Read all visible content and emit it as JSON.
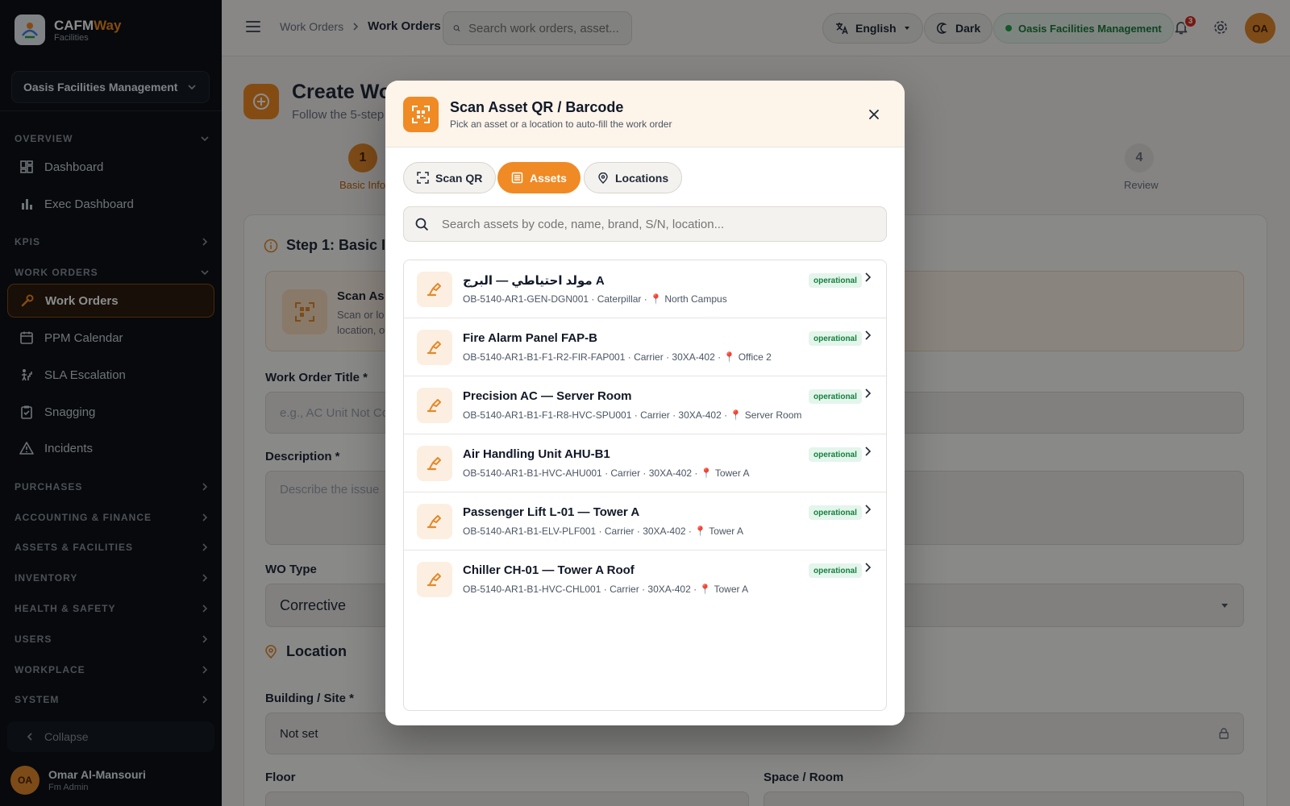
{
  "app": {
    "brand_main": "CAFM",
    "brand_accent": "Way",
    "brand_sub": "Facilities",
    "brand_color": "#f08a24"
  },
  "sidebar": {
    "org_selector": "Oasis Facilities Management",
    "sections": {
      "overview": "OVERVIEW",
      "kpis": "KPIS",
      "work_orders": "WORK ORDERS",
      "purchases": "PURCHASES",
      "accounting": "ACCOUNTING & FINANCE",
      "assets": "ASSETS & FACILITIES",
      "inventory": "INVENTORY",
      "health": "HEALTH & SAFETY",
      "users": "USERS",
      "workplace": "WORKPLACE",
      "system": "SYSTEM"
    },
    "items": {
      "dashboard": "Dashboard",
      "exec_dashboard": "Exec Dashboard",
      "work_orders": "Work Orders",
      "ppm_calendar": "PPM Calendar",
      "sla_escalation": "SLA Escalation",
      "snagging": "Snagging",
      "incidents": "Incidents"
    },
    "collapse": "Collapse",
    "user": {
      "initials": "OA",
      "name": "Omar Al-Mansouri",
      "role": "Fm Admin"
    }
  },
  "topbar": {
    "breadcrumb_parent": "Work Orders",
    "breadcrumb_current": "Work Orders",
    "search_placeholder": "Search work orders, asset...",
    "language": "English",
    "theme": "Dark",
    "org": "Oasis Facilities Management",
    "notification_count": "3",
    "avatar_initials": "OA"
  },
  "page": {
    "title": "Create Wo",
    "subtitle": "Follow the 5-step",
    "step1_number": "1",
    "step1_label": "Basic Info",
    "step4_number": "4",
    "step4_label": "Review",
    "card_heading": "Step 1: Basic In",
    "scan_title": "Scan As",
    "scan_desc": "Scan or lo location, o",
    "title_label": "Work Order Title *",
    "title_placeholder": "e.g., AC Unit Not Co",
    "desc_label": "Description *",
    "desc_placeholder": "Describe the issue",
    "wo_type_label": "WO Type",
    "wo_type_value": "Corrective",
    "location_heading": "Location",
    "building_label": "Building / Site *",
    "building_value": "Not set",
    "floor_label": "Floor",
    "space_label": "Space / Room"
  },
  "modal": {
    "title": "Scan Asset QR / Barcode",
    "subtitle": "Pick an asset or a location to auto-fill the work order",
    "tabs": {
      "scan_qr": "Scan QR",
      "assets": "Assets",
      "locations": "Locations"
    },
    "active_tab": "assets",
    "search_placeholder": "Search assets by code, name, brand, S/N, location...",
    "assets": [
      {
        "name": "مولد احتياطي — البرج A",
        "meta": "OB-5140-AR1-GEN-DGN001 · Caterpillar · 📍 North Campus",
        "status": "operational"
      },
      {
        "name": "Fire Alarm Panel FAP-B",
        "meta": "OB-5140-AR1-B1-F1-R2-FIR-FAP001 · Carrier · 30XA-402 · 📍 Office 2",
        "status": "operational"
      },
      {
        "name": "Precision AC — Server Room",
        "meta": "OB-5140-AR1-B1-F1-R8-HVC-SPU001 · Carrier · 30XA-402 · 📍 Server Room",
        "status": "operational"
      },
      {
        "name": "Air Handling Unit AHU-B1",
        "meta": "OB-5140-AR1-B1-HVC-AHU001 · Carrier · 30XA-402 · 📍 Tower A",
        "status": "operational"
      },
      {
        "name": "Passenger Lift L-01 — Tower A",
        "meta": "OB-5140-AR1-B1-ELV-PLF001 · Carrier · 30XA-402 · 📍 Tower A",
        "status": "operational"
      },
      {
        "name": "Chiller CH-01 — Tower A Roof",
        "meta": "OB-5140-AR1-B1-HVC-CHL001 · Carrier · 30XA-402 · 📍 Tower A",
        "status": "operational"
      }
    ]
  }
}
